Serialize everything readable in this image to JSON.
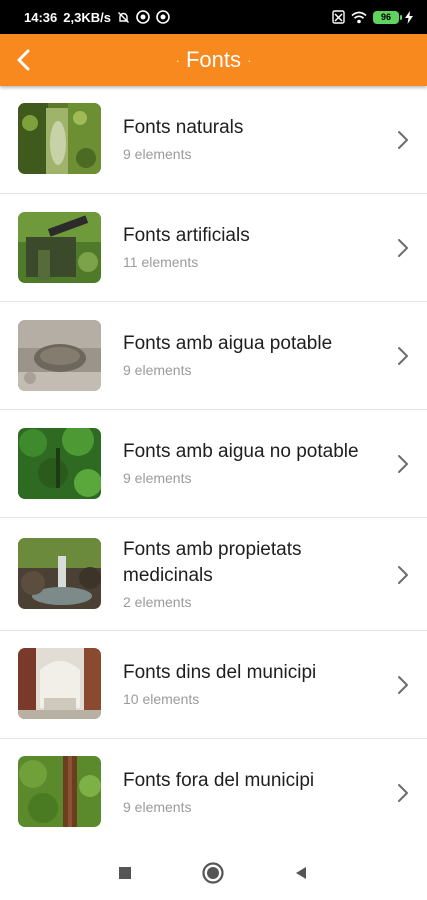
{
  "status_bar": {
    "time": "14:36",
    "speed": "2,3KB/s",
    "battery": "96"
  },
  "header": {
    "title": "Fonts",
    "dot": "·",
    "color": "#f7891f"
  },
  "items": [
    {
      "title": "Fonts naturals",
      "count": "9 elements",
      "thumb_icon": "moss-stream-photo"
    },
    {
      "title": "Fonts artificials",
      "count": "11 elements",
      "thumb_icon": "pipe-fountain-photo"
    },
    {
      "title": "Fonts amb aigua potable",
      "count": "9 elements",
      "thumb_icon": "stone-basin-photo"
    },
    {
      "title": "Fonts amb aigua no potable",
      "count": "9 elements",
      "thumb_icon": "forest-spring-photo"
    },
    {
      "title": "Fonts amb propietats medicinals",
      "count": "2 elements",
      "thumb_icon": "waterfall-rock-photo"
    },
    {
      "title": "Fonts dins del municipi",
      "count": "10 elements",
      "thumb_icon": "stone-monument-photo"
    },
    {
      "title": "Fonts fora del municipi",
      "count": "9 elements",
      "thumb_icon": "mossy-trunk-photo"
    }
  ],
  "nav": {
    "recent_icon": "square-icon",
    "home_icon": "circle-icon",
    "back_icon": "triangle-back-icon"
  }
}
